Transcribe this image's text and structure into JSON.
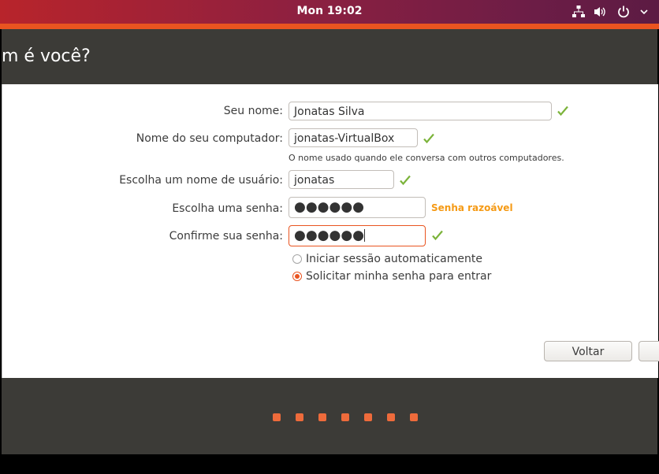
{
  "system": {
    "clock": "Mon 19:02",
    "tray_icons": [
      "network-icon",
      "volume-icon",
      "power-icon"
    ]
  },
  "window": {
    "title": "m é você?"
  },
  "form": {
    "name_label": "Seu nome:",
    "name_value": "Jonatas Silva",
    "computer_label": "Nome do seu computador:",
    "computer_value": "jonatas-VirtualBox",
    "computer_hint": "O nome usado quando ele conversa com outros computadores.",
    "username_label": "Escolha um nome de usuário:",
    "username_value": "jonatas",
    "password_label": "Escolha uma senha:",
    "password_value": "●●●●●●",
    "password_strength": "Senha razoável",
    "confirm_label": "Confirme sua senha:",
    "confirm_value": "●●●●●●",
    "login_auto": "Iniciar sessão automaticamente",
    "login_password": "Solicitar minha senha para entrar",
    "selected_login_option": "login_password"
  },
  "buttons": {
    "back": "Voltar"
  },
  "progress": {
    "total_steps": 7
  },
  "colors": {
    "accent": "#e95420",
    "check": "#7bb33a",
    "strength": "#f59a15",
    "header_bg": "#3c3b37"
  }
}
